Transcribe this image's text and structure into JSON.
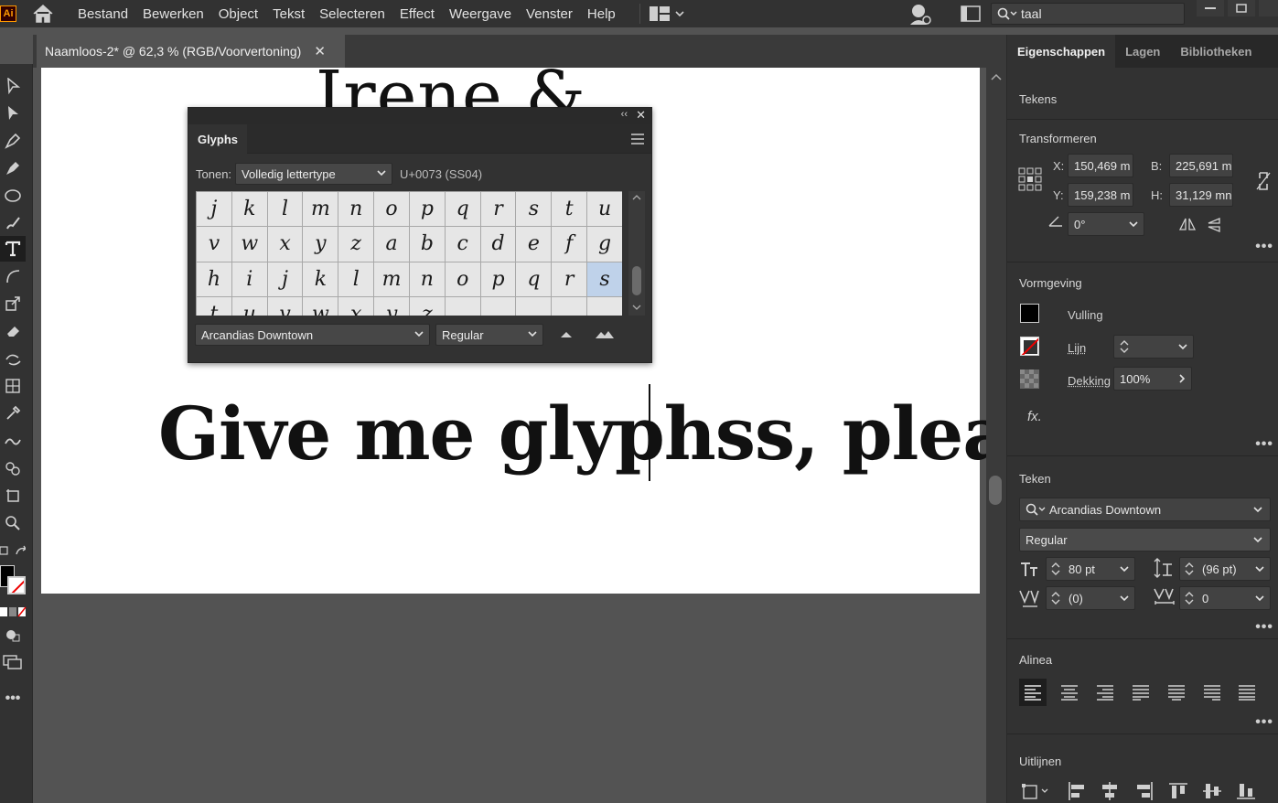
{
  "app": {
    "logo": "Ai",
    "menus": [
      "Bestand",
      "Bewerken",
      "Object",
      "Tekst",
      "Selecteren",
      "Effect",
      "Weergave",
      "Venster",
      "Help"
    ],
    "search_value": "taal"
  },
  "document": {
    "tab_title": "Naamloos-2* @ 62,3 % (RGB/Voorvertoning)",
    "text_top": "Irene &",
    "text_main": "Give me glyphss, please"
  },
  "glyphs_panel": {
    "tab": "Glyphs",
    "show_label": "Tonen:",
    "show_value": "Volledig lettertype",
    "unicode": "U+0073 (SS04)",
    "cells": [
      "j",
      "k",
      "l",
      "m",
      "n",
      "o",
      "p",
      "q",
      "r",
      "s",
      "t",
      "u",
      "v",
      "w",
      "x",
      "y",
      "z",
      "a",
      "b",
      "c",
      "d",
      "e",
      "f",
      "g",
      "h",
      "i",
      "j",
      "k",
      "l",
      "m",
      "n",
      "o",
      "p",
      "q",
      "r",
      "s",
      "t",
      "u",
      "v",
      "w",
      "x",
      "y",
      "z",
      "",
      "",
      "",
      "",
      ""
    ],
    "selected_index": 35,
    "font": "Arcandias Downtown",
    "style": "Regular"
  },
  "properties": {
    "tabs": [
      "Eigenschappen",
      "Lagen",
      "Bibliotheken"
    ],
    "tekens_label": "Tekens",
    "transform": {
      "title": "Transformeren",
      "x_label": "X:",
      "x": "150,469 m",
      "y_label": "Y:",
      "y": "159,238 m",
      "b_label": "B:",
      "b": "225,691 m",
      "h_label": "H:",
      "h": "31,129 mn",
      "angle": "0°"
    },
    "appearance": {
      "title": "Vormgeving",
      "fill": "Vulling",
      "stroke": "Lijn",
      "opacity_label": "Dekking",
      "opacity": "100%",
      "fx": "fx."
    },
    "character": {
      "title": "Teken",
      "font": "Arcandias Downtown",
      "style": "Regular",
      "size": "80 pt",
      "leading": "(96 pt)",
      "kerning": "(0)",
      "tracking": "0"
    },
    "paragraph_title": "Alinea",
    "align_title": "Uitlijnen"
  }
}
